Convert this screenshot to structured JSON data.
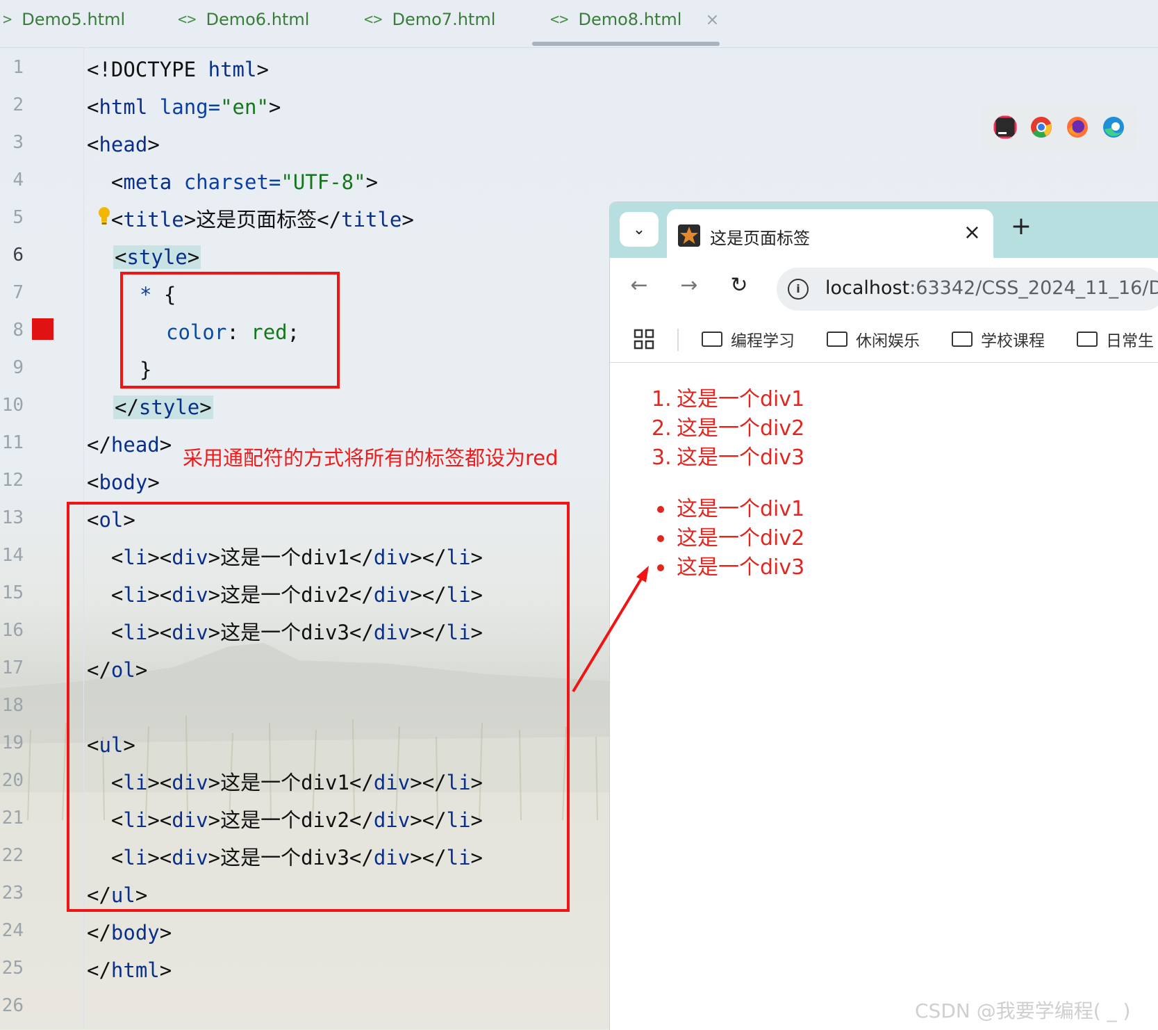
{
  "ide": {
    "tabs": [
      {
        "label": "Demo5.html",
        "active": false
      },
      {
        "label": "Demo6.html",
        "active": false
      },
      {
        "label": "Demo7.html",
        "active": false
      },
      {
        "label": "Demo8.html",
        "active": true
      }
    ],
    "tab_close": "×",
    "line_numbers": [
      "1",
      "2",
      "3",
      "4",
      "5",
      "6",
      "7",
      "8",
      "9",
      "10",
      "11",
      "12",
      "13",
      "14",
      "15",
      "16",
      "17",
      "18",
      "19",
      "20",
      "21",
      "22",
      "23",
      "24",
      "25",
      "26"
    ],
    "current_line": "6",
    "code": {
      "l1": {
        "a": "<!DOCTYPE ",
        "b": "html",
        "c": ">"
      },
      "l2": {
        "a": "<",
        "b": "html",
        "c": " lang=",
        "d": "\"en\"",
        "e": ">"
      },
      "l3": {
        "a": "<",
        "b": "head",
        "c": ">"
      },
      "l4": {
        "a": "  <",
        "b": "meta",
        "c": " charset=",
        "d": "\"UTF-8\"",
        "e": ">"
      },
      "l5": {
        "a": "  <",
        "b": "title",
        "c": ">这是页面标签</",
        "d": "title",
        "e": ">"
      },
      "l6": {
        "a": "<",
        "b": "style",
        "c": ">"
      },
      "l7": {
        "a": "* ",
        "b": "{"
      },
      "l8": {
        "a": "color",
        "b": ": ",
        "c": "red",
        "d": ";"
      },
      "l9": {
        "a": "}"
      },
      "l10": {
        "a": "</",
        "b": "style",
        "c": ">"
      },
      "l11": {
        "a": "</",
        "b": "head",
        "c": ">"
      },
      "l12": {
        "a": "<",
        "b": "body",
        "c": ">"
      },
      "l13": {
        "a": "<",
        "b": "ol",
        "c": ">"
      },
      "l14": {
        "a": "  <",
        "b": "li",
        "c": "><",
        "d": "div",
        "e": ">这是一个div1</",
        "f": "div",
        "g": "></",
        "h": "li",
        "i": ">"
      },
      "l15": {
        "a": "  <",
        "b": "li",
        "c": "><",
        "d": "div",
        "e": ">这是一个div2</",
        "f": "div",
        "g": "></",
        "h": "li",
        "i": ">"
      },
      "l16": {
        "a": "  <",
        "b": "li",
        "c": "><",
        "d": "div",
        "e": ">这是一个div3</",
        "f": "div",
        "g": "></",
        "h": "li",
        "i": ">"
      },
      "l17": {
        "a": "</",
        "b": "ol",
        "c": ">"
      },
      "l19": {
        "a": "<",
        "b": "ul",
        "c": ">"
      },
      "l20": {
        "a": "  <",
        "b": "li",
        "c": "><",
        "d": "div",
        "e": ">这是一个div1</",
        "f": "div",
        "g": "></",
        "h": "li",
        "i": ">"
      },
      "l21": {
        "a": "  <",
        "b": "li",
        "c": "><",
        "d": "div",
        "e": ">这是一个div2</",
        "f": "div",
        "g": "></",
        "h": "li",
        "i": ">"
      },
      "l22": {
        "a": "  <",
        "b": "li",
        "c": "><",
        "d": "div",
        "e": ">这是一个div3</",
        "f": "div",
        "g": "></",
        "h": "li",
        "i": ">"
      },
      "l23": {
        "a": "</",
        "b": "ul",
        "c": ">"
      },
      "l24": {
        "a": "</",
        "b": "body",
        "c": ">"
      },
      "l25": {
        "a": "</",
        "b": "html",
        "c": ">"
      }
    },
    "annotation": "采用通配符的方式将所有的标签都设为red",
    "icons": {
      "breakpoint": "breakpoint-icon",
      "bulb": "lightbulb-icon"
    }
  },
  "launchers": [
    "intellij-icon",
    "chrome-icon",
    "firefox-icon",
    "edge-icon"
  ],
  "browser": {
    "menu_glyph": "⌄",
    "tab_title": "这是页面标签",
    "tab_close": "×",
    "new_tab": "+",
    "back": "←",
    "forward": "→",
    "reload": "↻",
    "info": "i",
    "url_host": "localhost",
    "url_rest": ":63342/CSS_2024_11_16/D",
    "bookmarks": [
      "编程学习",
      "休闲娱乐",
      "学校课程",
      "日常生"
    ],
    "ol_items": [
      {
        "marker": "1.",
        "text": "这是一个div1"
      },
      {
        "marker": "2.",
        "text": "这是一个div2"
      },
      {
        "marker": "3.",
        "text": "这是一个div3"
      }
    ],
    "ul_items": [
      {
        "text": "这是一个div1"
      },
      {
        "text": "这是一个div2"
      },
      {
        "text": "这是一个div3"
      }
    ]
  },
  "watermark": "CSDN @我要学编程( _ )",
  "colors": {
    "annotation_red": "#f11414",
    "rendered_text": "#e0261f",
    "tab_green": "#3a7d3a"
  }
}
